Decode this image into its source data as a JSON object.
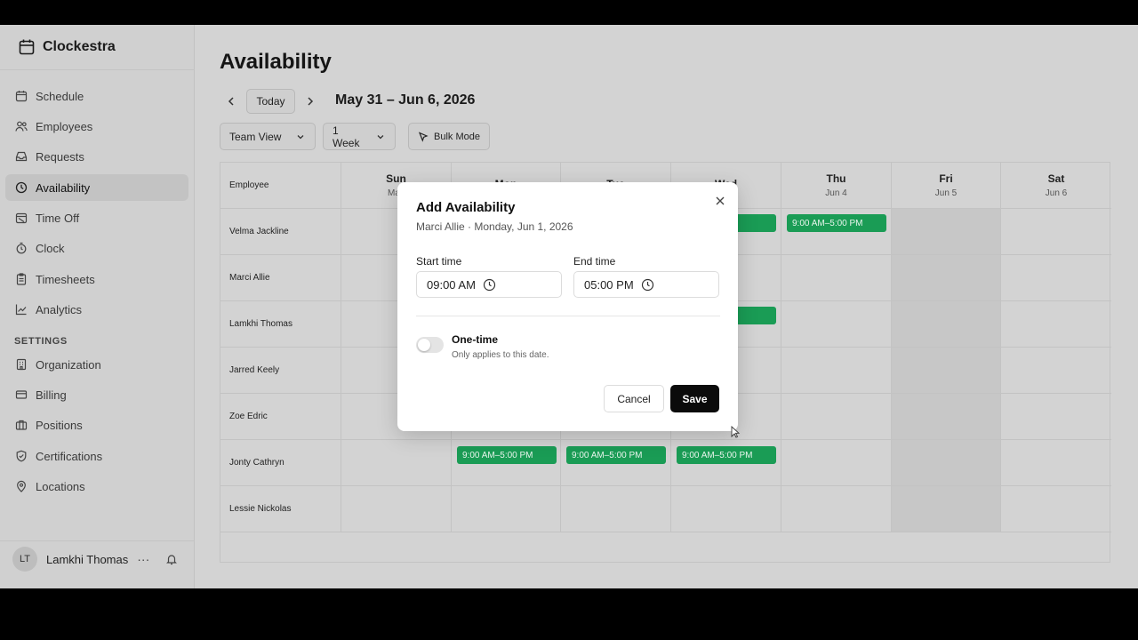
{
  "app": {
    "name": "Clockestra"
  },
  "sidebar": {
    "items": [
      {
        "label": "Schedule",
        "icon": "calendar-icon",
        "active": false
      },
      {
        "label": "Employees",
        "icon": "users-icon",
        "active": false
      },
      {
        "label": "Requests",
        "icon": "inbox-icon",
        "active": false
      },
      {
        "label": "Availability",
        "icon": "clock-icon",
        "active": true
      },
      {
        "label": "Time Off",
        "icon": "calendar-off-icon",
        "active": false
      },
      {
        "label": "Clock",
        "icon": "stopwatch-icon",
        "active": false
      },
      {
        "label": "Timesheets",
        "icon": "clipboard-icon",
        "active": false
      },
      {
        "label": "Analytics",
        "icon": "chart-line-icon",
        "active": false
      }
    ],
    "settings_label": "SETTINGS",
    "settings_items": [
      {
        "label": "Organization",
        "icon": "building-icon"
      },
      {
        "label": "Billing",
        "icon": "credit-card-icon"
      },
      {
        "label": "Positions",
        "icon": "briefcase-icon"
      },
      {
        "label": "Certifications",
        "icon": "shield-check-icon"
      },
      {
        "label": "Locations",
        "icon": "map-pin-icon"
      }
    ],
    "user": {
      "initials": "LT",
      "name": "Lamkhi Thomas",
      "more": "···"
    }
  },
  "main": {
    "title": "Availability",
    "today_label": "Today",
    "date_range": "May 31 – Jun 6, 2026",
    "view_select": "Team View",
    "period_select": "1 Week",
    "bulk_mode_label": "Bulk Mode"
  },
  "grid": {
    "employee_header": "Employee",
    "days": [
      {
        "name": "Sun",
        "date": "May"
      },
      {
        "name": "Mon",
        "date": ""
      },
      {
        "name": "Tue",
        "date": ""
      },
      {
        "name": "Wed",
        "date": ""
      },
      {
        "name": "Thu",
        "date": "Jun 4"
      },
      {
        "name": "Fri",
        "date": "Jun 5"
      },
      {
        "name": "Sat",
        "date": "Jun 6"
      }
    ],
    "employees": [
      "Velma Jackline",
      "Marci Allie",
      "Lamkhi Thomas",
      "Jarred Keely",
      "Zoe Edric",
      "Jonty Cathryn",
      "Lessie Nickolas"
    ],
    "chips": {
      "row1_wed": "PM",
      "row1_thu": "9:00 AM–5:00 PM",
      "row3_wed": "PM",
      "row6_mon": "9:00 AM–5:00 PM",
      "row6_tue": "9:00 AM–5:00 PM",
      "row6_wed": "9:00 AM–5:00 PM"
    },
    "shift_color": "#1a9c55"
  },
  "modal": {
    "title": "Add Availability",
    "subtitle": "Marci Allie · Monday, Jun 1, 2026",
    "start_label": "Start time",
    "start_value": "09:00 AM",
    "end_label": "End time",
    "end_value": "05:00 PM",
    "toggle_label": "One-time",
    "toggle_hint": "Only applies to this date.",
    "toggle_on": false,
    "cancel_label": "Cancel",
    "save_label": "Save"
  }
}
